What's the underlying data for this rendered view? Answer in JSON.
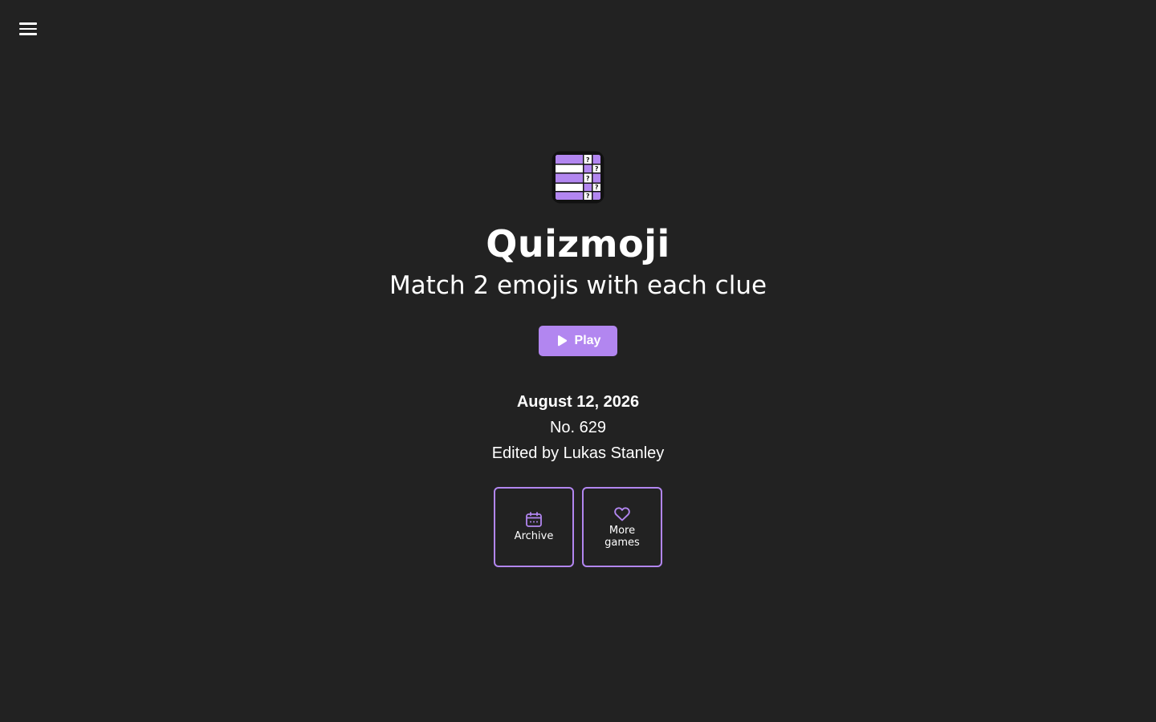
{
  "nav": {
    "menu_icon": "hamburger-icon"
  },
  "brand": {
    "logo_icon": "quizmoji-grid-logo",
    "title": "Quizmoji",
    "subtitle": "Match 2 emojis with each clue"
  },
  "play_button": {
    "label": "Play",
    "icon": "play-icon"
  },
  "puzzle": {
    "date": "August 12, 2026",
    "number": "No. 629",
    "editor": "Edited by Lukas Stanley"
  },
  "tiles": [
    {
      "label": "Archive",
      "icon": "calendar-icon"
    },
    {
      "label": "More games",
      "icon": "heart-icon"
    }
  ],
  "colors": {
    "background": "#222222",
    "accent": "#b286f0",
    "text": "#ffffff"
  }
}
